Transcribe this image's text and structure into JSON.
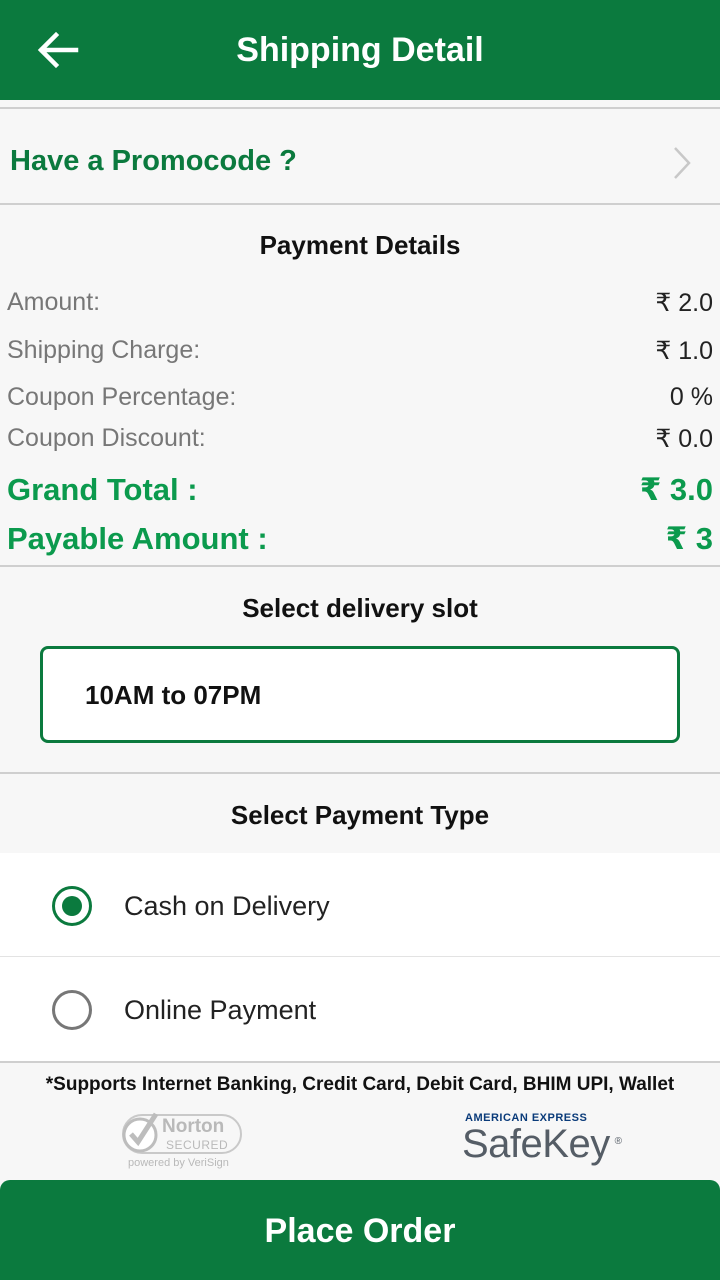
{
  "header": {
    "title": "Shipping Detail",
    "back_icon": "arrow-left-icon",
    "bg_color": "#0b7a3e"
  },
  "promo": {
    "label": "Have a Promocode ?",
    "chevron_icon": "chevron-right-icon"
  },
  "payment_details": {
    "title": "Payment Details",
    "rows": [
      {
        "label": "Amount:",
        "value": "₹ 2.0"
      },
      {
        "label": "Shipping Charge:",
        "value": "₹ 1.0"
      },
      {
        "label": "Coupon Percentage:",
        "value": "0 %"
      },
      {
        "label": "Coupon Discount:",
        "value": "₹ 0.0"
      }
    ],
    "grand_total": {
      "label": "Grand Total :",
      "value": "₹ 3.0"
    },
    "payable_amount": {
      "label": "Payable Amount :",
      "value": "₹ 3"
    }
  },
  "delivery": {
    "title": "Select delivery slot",
    "selected_slot": "10AM to 07PM"
  },
  "payment_type": {
    "title": "Select Payment Type",
    "options": [
      {
        "label": "Cash on Delivery",
        "selected": true
      },
      {
        "label": "Online Payment",
        "selected": false
      }
    ]
  },
  "supports_text": "*Supports Internet Banking, Credit Card, Debit Card, BHIM UPI, Wallet",
  "badges": {
    "norton": {
      "name": "Norton",
      "secured": "SECURED",
      "powered": "powered by VeriSign"
    },
    "amex": {
      "brand": "AMERICAN EXPRESS",
      "name": "SafeKey"
    }
  },
  "place_order": {
    "label": "Place Order"
  },
  "colors": {
    "primary": "#0b7a3e",
    "accent_text": "#0b9a4d"
  }
}
